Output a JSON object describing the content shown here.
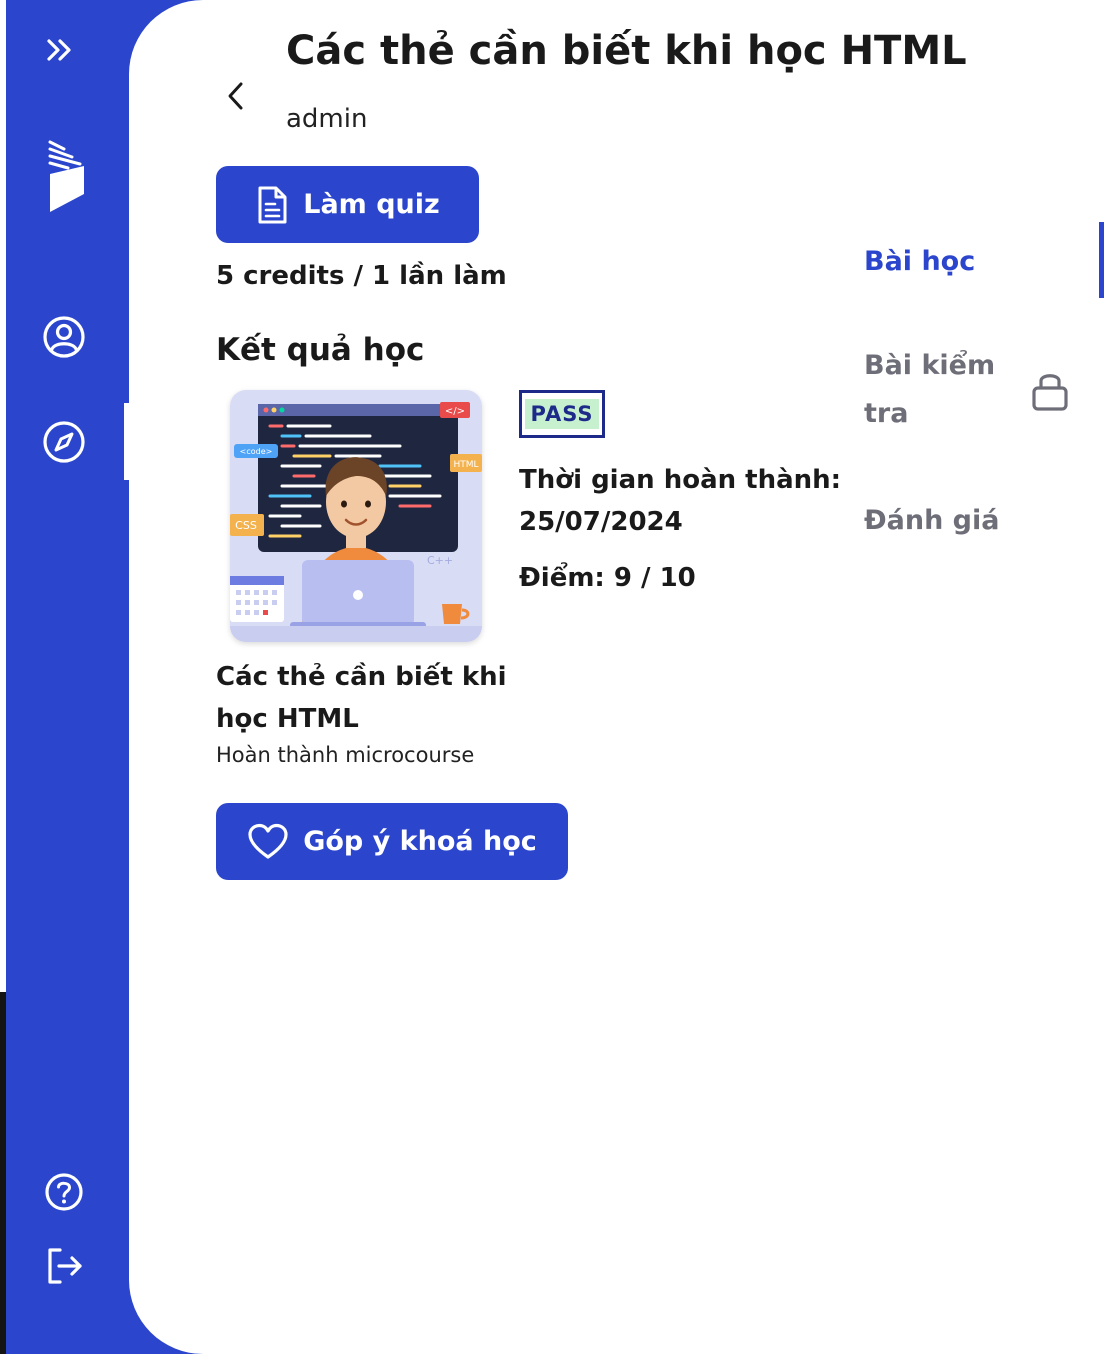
{
  "page": {
    "title": "Các thẻ cần biết khi học HTML",
    "author": "admin"
  },
  "quiz": {
    "button_label": "Làm quiz",
    "credits_text": "5 credits / 1 lần làm"
  },
  "results": {
    "section_title": "Kết quả học",
    "course_name": "Các thẻ cần biết khi học HTML",
    "course_subtitle": "Hoàn thành microcourse",
    "status_badge": "PASS",
    "completion_label": "Thời gian hoàn thành:",
    "completion_date": "25/07/2024",
    "score_text": "Điểm: 9 / 10"
  },
  "thumbnail": {
    "tags": {
      "code": "<code>",
      "html": "HTML",
      "css": "CSS",
      "cpp": "C++",
      "close_tag": "</>"
    }
  },
  "feedback": {
    "button_label": "Góp ý khoá học"
  },
  "tabs": {
    "items": [
      {
        "label": "Bài học",
        "active": true,
        "locked": false
      },
      {
        "label": "Bài kiểm tra",
        "active": false,
        "locked": true
      },
      {
        "label": "Đánh giá",
        "active": false,
        "locked": false
      }
    ]
  },
  "sidebar": {
    "icons": [
      "expand-icon",
      "logo-icon",
      "profile-icon",
      "compass-icon",
      "help-icon",
      "logout-icon"
    ],
    "active_item": "compass-icon"
  },
  "colors": {
    "primary": "#2b46cc",
    "pass_bg": "#c7f0cf",
    "pass_text": "#1d2a8a",
    "muted_text": "#6e6e78"
  }
}
